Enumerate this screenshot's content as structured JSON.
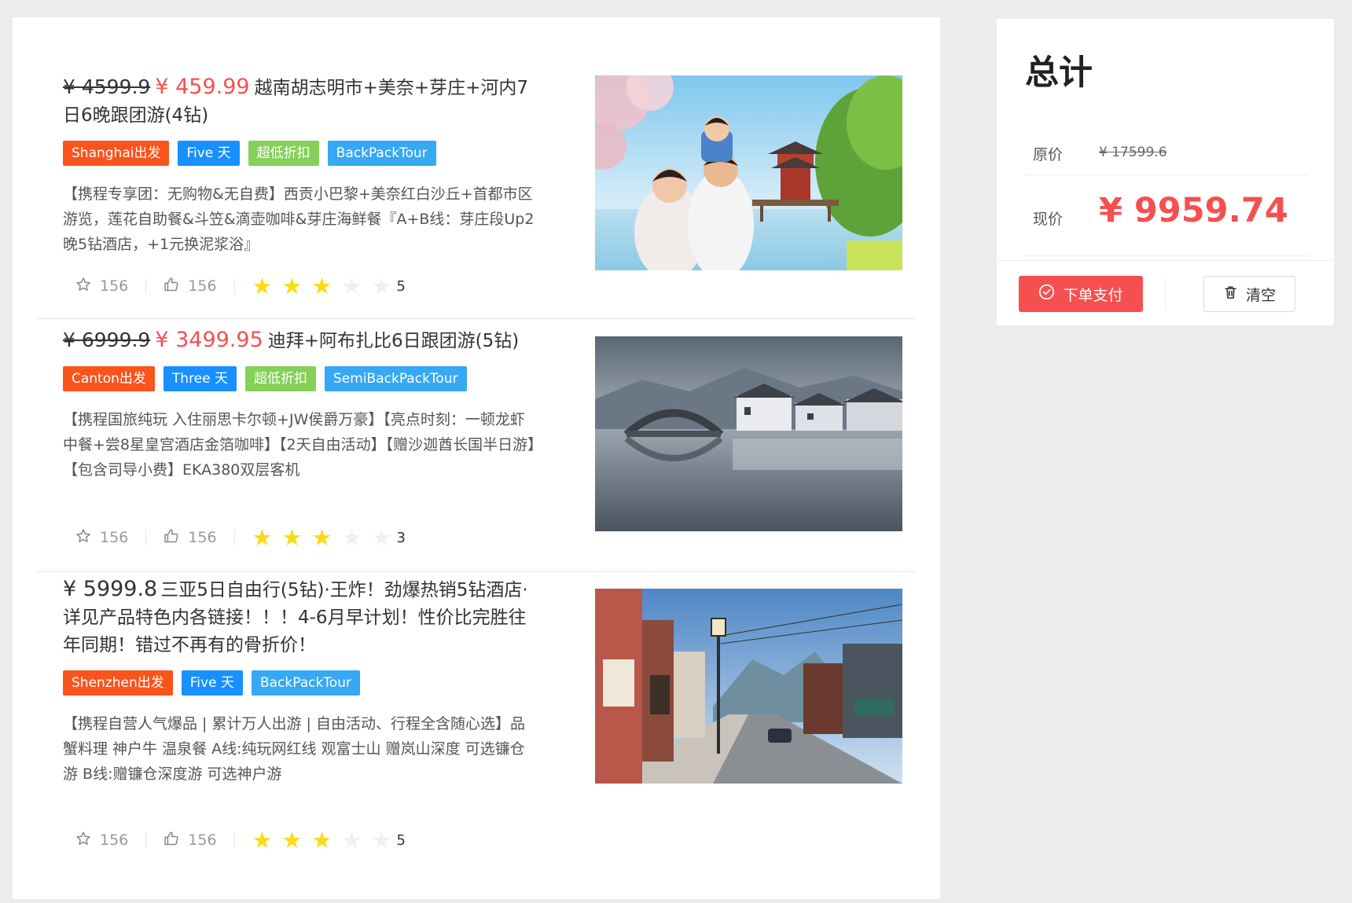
{
  "items": [
    {
      "old_price": "¥ 4599.9",
      "price": "¥ 459.99",
      "title": "越南胡志明市+美奈+芽庄+河内7日6晚跟团游(4钻)",
      "tags": [
        {
          "label": "Shanghai出发",
          "color": "#fa541c"
        },
        {
          "label": "Five 天",
          "color": "#1890ff"
        },
        {
          "label": "超低折扣",
          "color": "#84d059"
        },
        {
          "label": "BackPackTour",
          "color": "#36a8f4"
        }
      ],
      "description": "【携程专享团：无购物&无自费】西贡小巴黎+美奈红白沙丘+首都市区游览，莲花自助餐&斗笠&滴壶咖啡&芽庄海鲜餐『A+B线：芽庄段Up2晚5钻酒店，+1元换泥浆浴』",
      "favorites": "156",
      "likes": "156",
      "rating": 3,
      "rating_label": "5",
      "image": "family-pagoda-lake-photo"
    },
    {
      "old_price": "¥ 6999.9",
      "price": "¥ 3499.95",
      "title": "迪拜+阿布扎比6日跟团游(5钻)",
      "tags": [
        {
          "label": "Canton出发",
          "color": "#fa541c"
        },
        {
          "label": "Three 天",
          "color": "#1890ff"
        },
        {
          "label": "超低折扣",
          "color": "#84d059"
        },
        {
          "label": "SemiBackPackTour",
          "color": "#36a8f4"
        }
      ],
      "description": "【携程国旅纯玩 入住丽思卡尔顿+JW侯爵万豪】【亮点时刻：一顿龙虾中餐+尝8星皇宫酒店金箔咖啡】【2天自由活动】【赠沙迦酋长国半日游】【包含司导小费】EKA380双层客机",
      "favorites": "156",
      "likes": "156",
      "rating": 3,
      "rating_label": "3",
      "image": "stone-bridge-village-lake-photo"
    },
    {
      "old_price": "",
      "price": "¥ 5999.8",
      "title": "三亚5日自由行(5钻)·王炸！劲爆热销5钻酒店·详见产品特色内各链接！！！4-6月早计划！性价比完胜往年同期！错过不再有的骨折价！",
      "tags": [
        {
          "label": "Shenzhen出发",
          "color": "#fa541c"
        },
        {
          "label": "Five 天",
          "color": "#1890ff"
        },
        {
          "label": "BackPackTour",
          "color": "#36a8f4"
        }
      ],
      "description": "【携程自营人气爆品 | 累计万人出游 | 自由活动、行程全含随心选】品蟹料理 神户牛 温泉餐 A线:纯玩网红线 观富士山 赠岚山深度 可选镰仓游 B线:赠镰仓深度游 可选神户游",
      "favorites": "156",
      "likes": "156",
      "rating": 3,
      "rating_label": "5",
      "image": "japanese-street-mountain-photo"
    }
  ],
  "summary": {
    "title": "总计",
    "original_label": "原价",
    "original_value": "¥ 17599.6",
    "current_label": "现价",
    "current_value": "¥ 9959.74",
    "pay_label": "下单支付",
    "clear_label": "清空"
  },
  "colors": {
    "price_red": "#f5504f",
    "star_on": "#fadb14",
    "star_off": "#f0f0f0"
  }
}
